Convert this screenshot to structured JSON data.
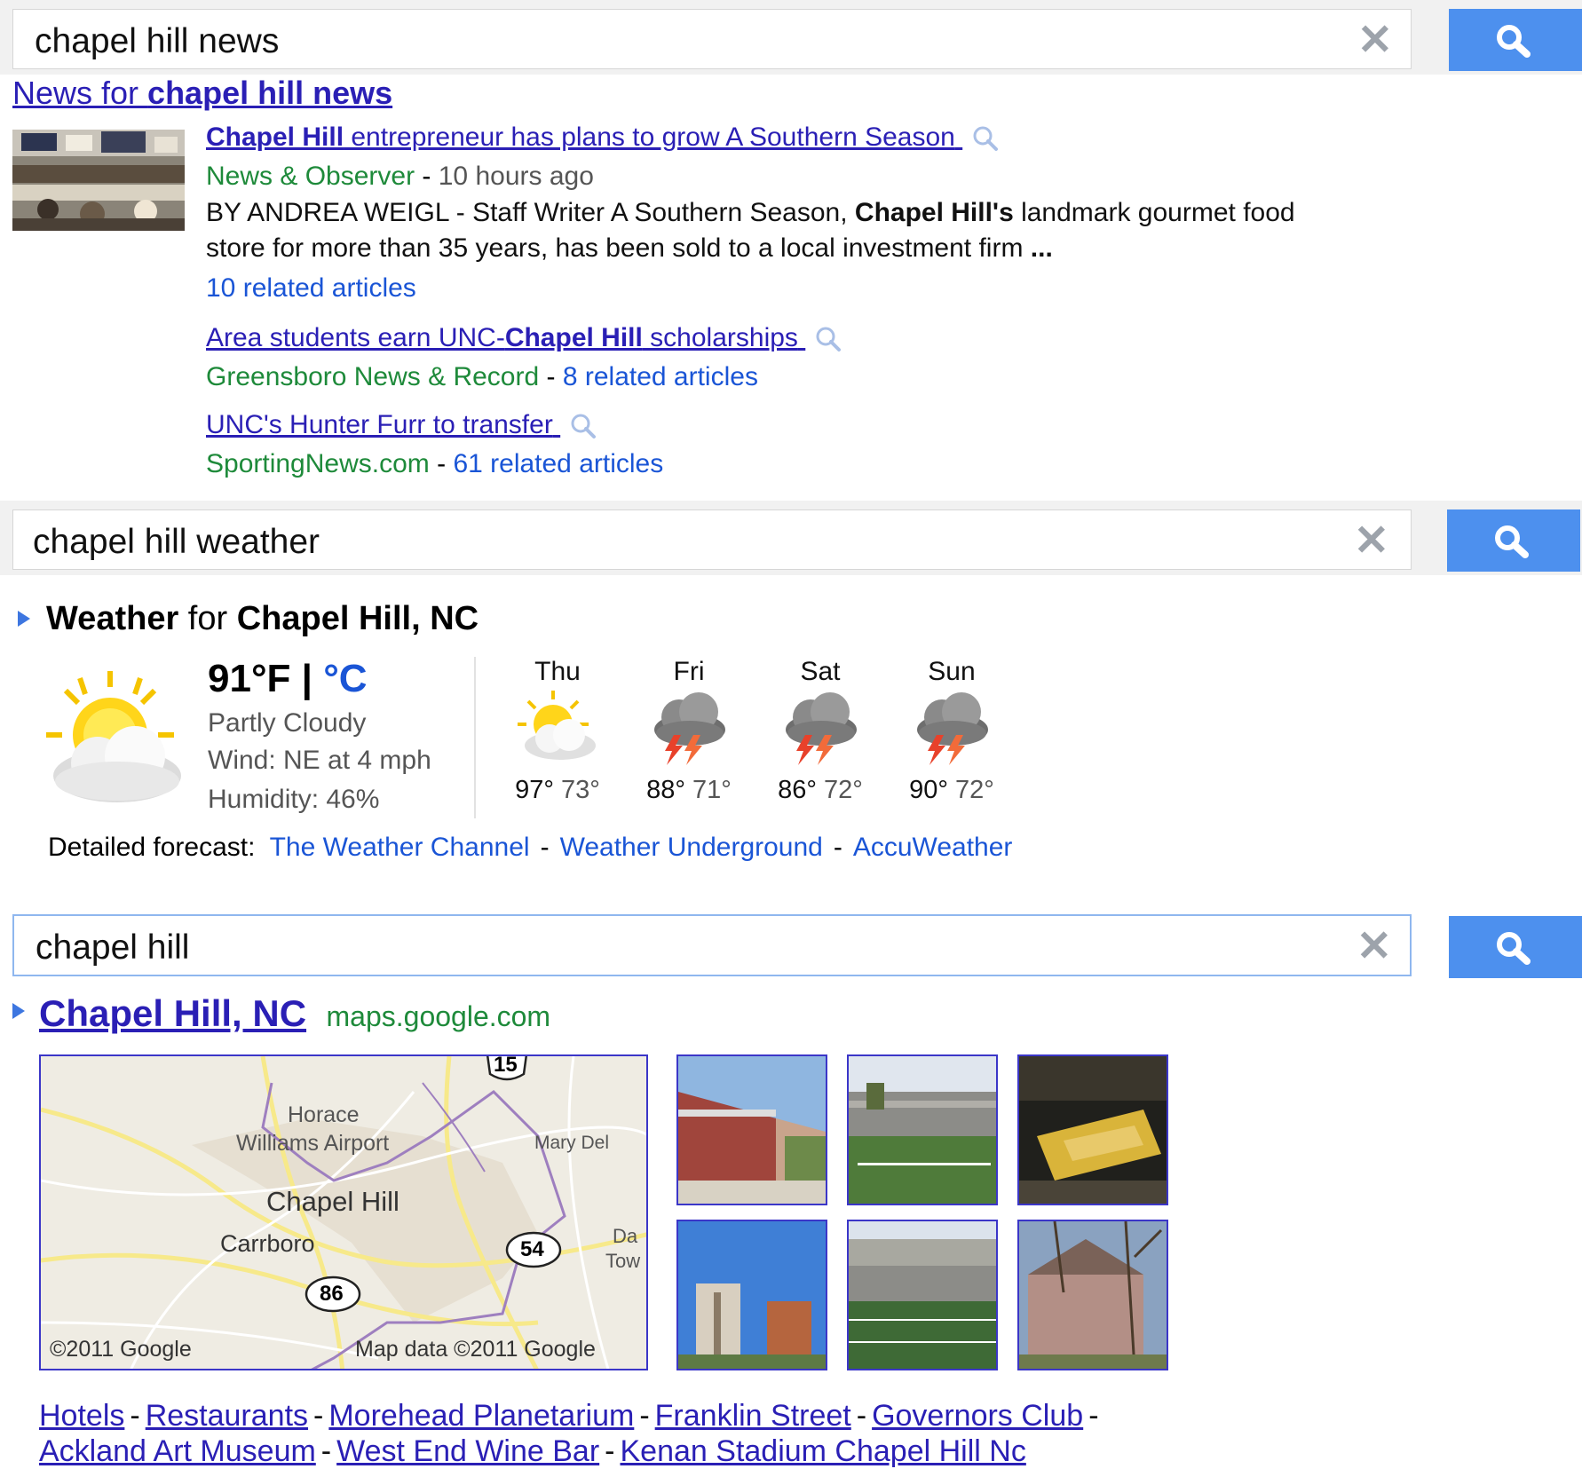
{
  "searches": [
    {
      "query": "chapel hill news"
    },
    {
      "query": "chapel hill weather"
    },
    {
      "query": "chapel hill"
    }
  ],
  "clear_glyph": "✕",
  "news": {
    "heading_prefix": "News for ",
    "heading_bold": "chapel hill news",
    "main": {
      "title_bold": "Chapel Hill",
      "title_rest": " entrepreneur has plans to grow A Southern Season",
      "source": "News & Observer",
      "age": "10 hours ago",
      "snippet_a": "BY ANDREA WEIGL - Staff Writer A Southern Season, ",
      "snippet_bold": "Chapel Hill's",
      "snippet_b": " landmark gourmet food store for more than 35 years, has been sold to a local investment firm ",
      "snippet_ellipsis": "...",
      "related": "10 related articles"
    },
    "second": {
      "title_a": "Area students earn UNC-",
      "title_bold": "Chapel Hill",
      "title_b": " scholarships",
      "source": "Greensboro News & Record",
      "related": "8 related articles"
    },
    "third": {
      "title": "UNC's Hunter Furr to transfer",
      "source": "SportingNews.com",
      "related": "61 related articles"
    },
    "dash": " - "
  },
  "weather": {
    "title_bold1": "Weather",
    "title_mid": " for ",
    "title_bold2": "Chapel Hill, NC",
    "temp_f": "91°F",
    "pipe": " | ",
    "temp_c": "°C",
    "condition": "Partly Cloudy",
    "wind": "Wind: NE at 4 mph",
    "humidity": "Humidity: 46%",
    "days": [
      {
        "name": "Thu",
        "high": "97°",
        "low": "73°",
        "icon": "sun-cloud-icon"
      },
      {
        "name": "Fri",
        "high": "88°",
        "low": "71°",
        "icon": "thunderstorm-icon"
      },
      {
        "name": "Sat",
        "high": "86°",
        "low": "72°",
        "icon": "thunderstorm-icon"
      },
      {
        "name": "Sun",
        "high": "90°",
        "low": "72°",
        "icon": "thunderstorm-icon"
      }
    ],
    "detailed_label": "Detailed forecast:",
    "links": [
      "The Weather Channel",
      "Weather Underground",
      "AccuWeather"
    ]
  },
  "place": {
    "title": "Chapel Hill, NC",
    "source": "maps.google.com",
    "map_labels": {
      "airport_1": "Horace",
      "airport_2": "Williams Airport",
      "city": "Chapel Hill",
      "carrboro": "Carrboro",
      "mary": "Mary Del",
      "da": "Da",
      "tow": "Tow",
      "shield_15": "15",
      "shield_54": "54",
      "shield_86": "86",
      "copyright": "©2011 Google",
      "mapdata": "Map data ©2011 Google"
    },
    "links_row1": [
      "Hotels",
      "Restaurants",
      "Morehead Planetarium",
      "Franklin Street",
      "Governors Club"
    ],
    "links_row2": [
      "Ackland Art Museum",
      "West End Wine Bar",
      "Kenan Stadium Chapel Hill Nc"
    ]
  },
  "colors": {
    "button_blue": "#4d90ee",
    "link_blue": "#2a1fb5",
    "source_green": "#1e8a3a"
  }
}
